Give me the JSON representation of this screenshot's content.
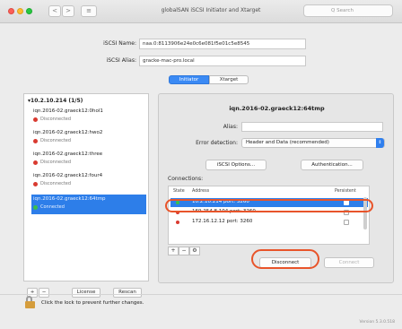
{
  "window": {
    "title": "globalSAN iSCSI Initiator and Xtarget",
    "search_placeholder": "Q Search",
    "back_glyph": "<",
    "forward_glyph": ">",
    "list_glyph": "≡"
  },
  "initiator": {
    "name_label": "iSCSI Name:",
    "name_value": "naa.0:8113906e24e0c6e081f5e01c5e8545",
    "alias_label": "iSCSI Alias:",
    "alias_value": "gracke-mac-pro.local"
  },
  "tabs": {
    "initiator": "Initiator",
    "xtarget": "Xtarget"
  },
  "portal": {
    "label": "10.2.10.214 (1/5)",
    "targets": [
      {
        "name": "iqn.2016-02.graeck12:0hol1",
        "status": "Disconnected"
      },
      {
        "name": "iqn.2016-02.graeck12:hwo2",
        "status": "Disconnected"
      },
      {
        "name": "iqn.2016-02.graeck12:three",
        "status": "Disconnected"
      },
      {
        "name": "iqn.2016-02.graeck12:four4",
        "status": "Disconnected"
      },
      {
        "name": "iqn.2016-02.graeck12:64tmp",
        "status": "Connected"
      }
    ]
  },
  "left_footer": {
    "add": "+",
    "remove": "−",
    "license": "License",
    "rescan": "Rescan"
  },
  "detail": {
    "title": "iqn.2016-02.graeck12:64tmp",
    "alias_label": "Alias:",
    "error_label": "Error detection:",
    "error_value": "Header and Data (recommended)",
    "iscsi_options": "iSCSI Options...",
    "authentication": "Authentication...",
    "connections_label": "Connections:",
    "col_state": "State",
    "col_address": "Address",
    "col_persistent": "Persistent",
    "connections": [
      {
        "address": "10.2.10.214 port: 3260",
        "state_color": "#3ac04b"
      },
      {
        "address": "169.254.8.104 port: 3260",
        "state_color": "#d93a30"
      },
      {
        "address": "172.16.12.12 port: 3260",
        "state_color": "#d93a30"
      }
    ],
    "add": "+",
    "remove": "−",
    "gear": "⚙",
    "disconnect": "Disconnect",
    "connect": "Connect"
  },
  "bottom": {
    "lock_message": "Click the lock to prevent further changes.",
    "version": "Version 5.3.0.518"
  },
  "colors": {
    "accent": "#2d7ee9",
    "callout": "#e8542a",
    "connected": "#3ac04b",
    "disconnected": "#d93a30"
  }
}
